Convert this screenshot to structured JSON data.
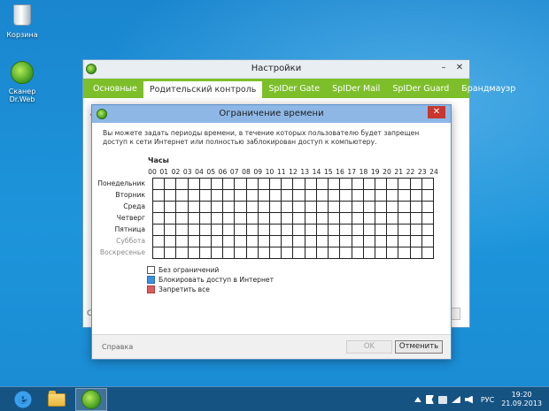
{
  "desktop": {
    "icons": [
      {
        "label": "Корзина"
      },
      {
        "label": "Сканер Dr.Web"
      }
    ]
  },
  "main_window": {
    "title": "Настройки",
    "tabs": [
      {
        "label": "Основные"
      },
      {
        "label": "Родительский контроль",
        "active": true
      },
      {
        "label": "SpIDer Gate"
      },
      {
        "label": "SpIDer Mail"
      },
      {
        "label": "SpIDer Guard"
      },
      {
        "label": "Брандмауэр"
      }
    ],
    "partial_text_left": "•",
    "partial_text_bottom": "С"
  },
  "dialog": {
    "title": "Ограничение времени",
    "description": "Вы можете задать периоды времени, в течение которых пользователю будет запрещен доступ к сети Интернет или полностью заблокирован доступ к компьютеру.",
    "hours_title": "Часы",
    "hours": [
      "00",
      "01",
      "02",
      "03",
      "04",
      "05",
      "06",
      "07",
      "08",
      "09",
      "10",
      "11",
      "12",
      "13",
      "14",
      "15",
      "16",
      "17",
      "18",
      "19",
      "20",
      "21",
      "22",
      "23",
      "24"
    ],
    "days": [
      {
        "label": "Понедельник",
        "weekend": false
      },
      {
        "label": "Вторник",
        "weekend": false
      },
      {
        "label": "Среда",
        "weekend": false
      },
      {
        "label": "Четверг",
        "weekend": false
      },
      {
        "label": "Пятница",
        "weekend": false
      },
      {
        "label": "Суббота",
        "weekend": true
      },
      {
        "label": "Воскресенье",
        "weekend": true
      }
    ],
    "legend": [
      {
        "label": "Без ограничений",
        "color": "#ffffff"
      },
      {
        "label": "Блокировать доступ в Интернет",
        "color": "#3d8fe0"
      },
      {
        "label": "Запретить все",
        "color": "#e05a5a"
      }
    ],
    "help_label": "Справка",
    "ok_label": "OK",
    "cancel_label": "Отменить"
  },
  "taskbar": {
    "language": "РУС",
    "time": "19:20",
    "date": "21.09.2013"
  },
  "colors": {
    "tab_bar": "#7dbf2a",
    "dialog_title": "#8eb7e6",
    "close_button": "#c7372e"
  }
}
